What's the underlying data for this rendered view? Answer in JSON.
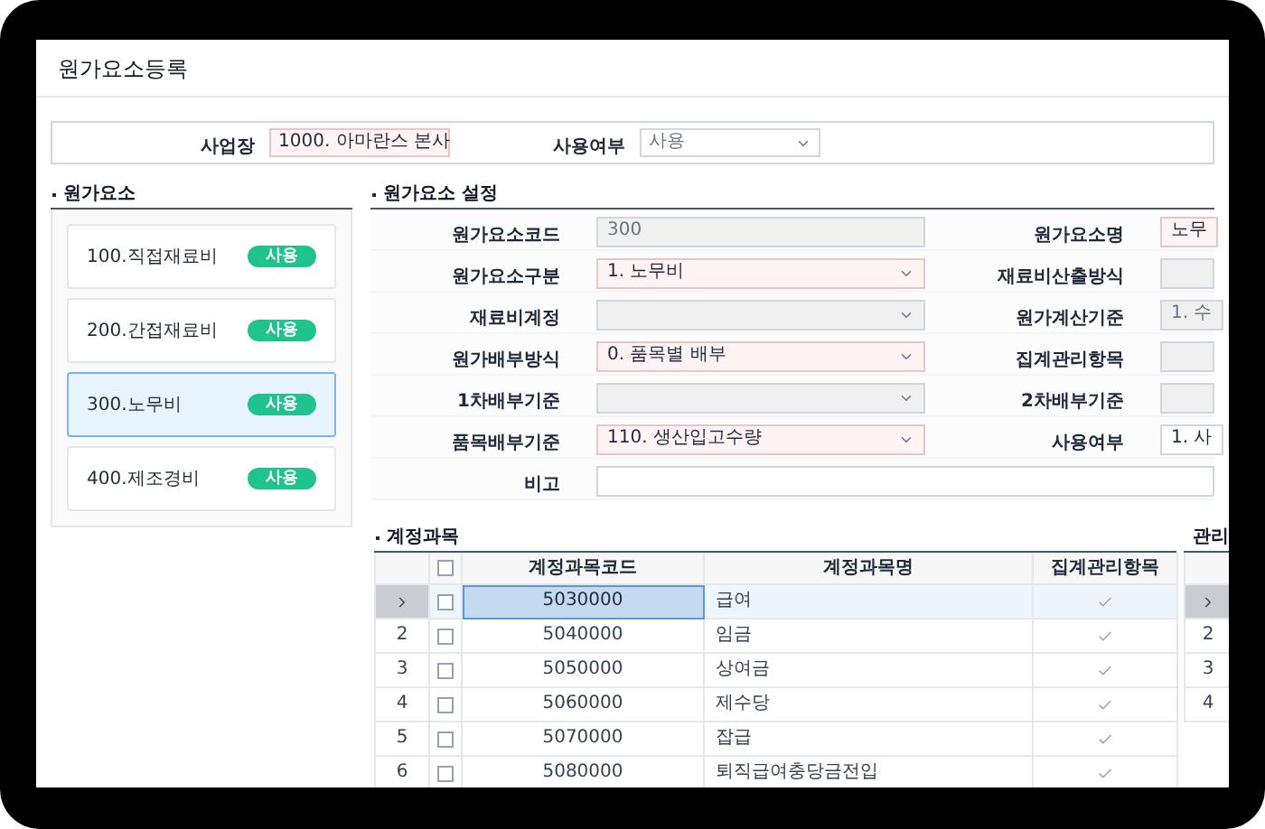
{
  "window": {
    "title": "원가요소등록"
  },
  "filter": {
    "fields": [
      {
        "label": "사업장",
        "value": "1000. 아마란스 본사",
        "kind": "lookup",
        "required": true
      },
      {
        "label": "사용여부",
        "value": "사용",
        "kind": "select",
        "required": false
      }
    ]
  },
  "cost_elements": {
    "title": "원가요소",
    "items": [
      {
        "name": "100.직접재료비",
        "badge": "사용",
        "selected": false
      },
      {
        "name": "200.간접재료비",
        "badge": "사용",
        "selected": false
      },
      {
        "name": "300.노무비",
        "badge": "사용",
        "selected": true
      },
      {
        "name": "400.제조경비",
        "badge": "사용",
        "selected": false
      }
    ]
  },
  "settings": {
    "title": "원가요소 설정",
    "rows": [
      {
        "cells": [
          {
            "label": "원가요소코드",
            "value": "300",
            "kind": "text",
            "required": false,
            "disabled": true
          },
          {
            "label": "원가요소명",
            "value": "노무",
            "kind": "text",
            "required": true,
            "disabled": false
          }
        ]
      },
      {
        "cells": [
          {
            "label": "원가요소구분",
            "value": "1. 노무비",
            "kind": "select",
            "required": true,
            "disabled": false
          },
          {
            "label": "재료비산출방식",
            "kind": "text",
            "required": false,
            "disabled": true
          }
        ]
      },
      {
        "cells": [
          {
            "label": "재료비계정",
            "kind": "select",
            "required": false,
            "disabled": true
          },
          {
            "label": "원가계산기준",
            "value": "1. 수",
            "kind": "text",
            "required": false,
            "disabled": true
          }
        ]
      },
      {
        "cells": [
          {
            "label": "원가배부방식",
            "value": "0. 품목별 배부",
            "kind": "select",
            "required": true,
            "disabled": false
          },
          {
            "label": "집계관리항목",
            "kind": "text",
            "required": false,
            "disabled": true
          }
        ]
      },
      {
        "cells": [
          {
            "label": "1차배부기준",
            "kind": "select",
            "required": false,
            "disabled": true
          },
          {
            "label": "2차배부기준",
            "kind": "text",
            "required": false,
            "disabled": true
          }
        ]
      },
      {
        "cells": [
          {
            "label": "품목배부기준",
            "value": "110. 생산입고수량",
            "kind": "select",
            "required": true,
            "disabled": false
          },
          {
            "label": "사용여부",
            "value": "1. 사",
            "kind": "text",
            "required": false,
            "disabled": false
          }
        ]
      },
      {
        "cells": [
          {
            "label": "비고",
            "kind": "wide",
            "required": false,
            "disabled": false
          }
        ]
      }
    ]
  },
  "accounts": {
    "title": "계정과목",
    "all_checked": false,
    "columns": [
      "계정과목코드",
      "계정과목명",
      "집계관리항목"
    ],
    "rows": [
      {
        "selected": true,
        "checked": false,
        "code": "5030000",
        "name": "급여",
        "aggregated": true
      },
      {
        "selected": false,
        "number": "2",
        "checked": false,
        "code": "5040000",
        "name": "임금",
        "aggregated": true
      },
      {
        "selected": false,
        "number": "3",
        "checked": false,
        "code": "5050000",
        "name": "상여금",
        "aggregated": true
      },
      {
        "selected": false,
        "number": "4",
        "checked": false,
        "code": "5060000",
        "name": "제수당",
        "aggregated": true
      },
      {
        "selected": false,
        "number": "5",
        "checked": false,
        "code": "5070000",
        "name": "잡급",
        "aggregated": true
      },
      {
        "selected": false,
        "number": "6",
        "checked": false,
        "code": "5080000",
        "name": "퇴직급여충당금전입",
        "aggregated": true
      }
    ]
  },
  "management": {
    "title": "관리",
    "rows": [
      {
        "selected": true
      },
      {
        "selected": false,
        "number": "2"
      },
      {
        "selected": false,
        "number": "3"
      },
      {
        "selected": false,
        "number": "4"
      }
    ]
  }
}
